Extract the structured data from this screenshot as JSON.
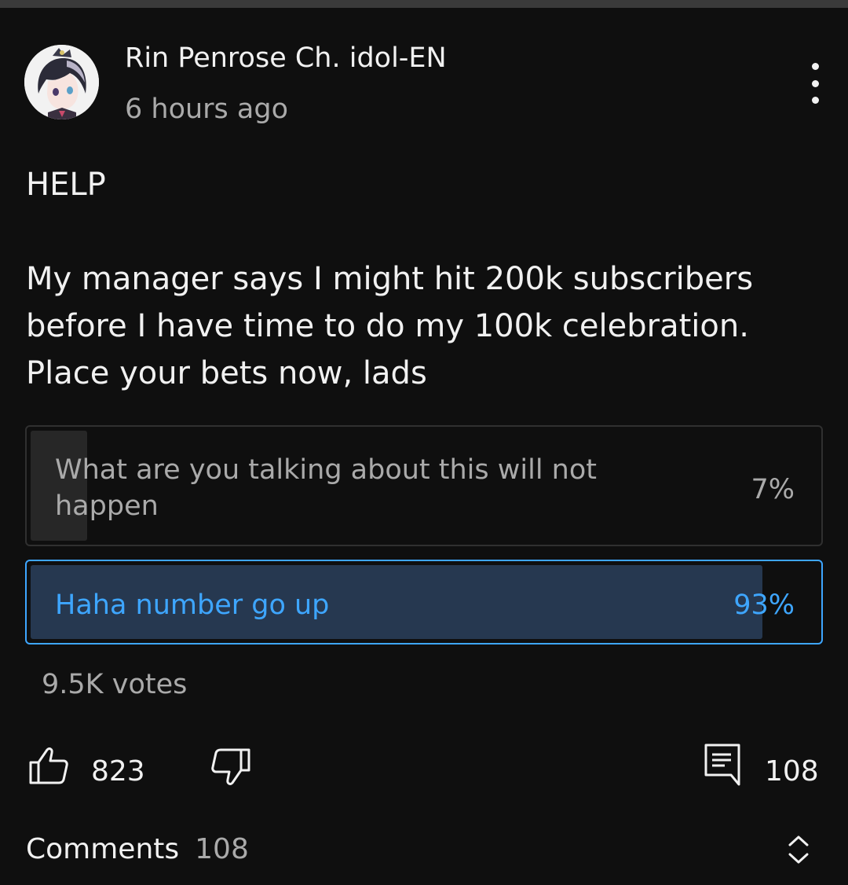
{
  "channel": {
    "name": "Rin Penrose Ch. idol-EN",
    "time": "6 hours ago"
  },
  "post": {
    "lines": [
      "HELP",
      "My manager says I might hit 200k subscribers",
      "before I have time to do my 100k celebration.",
      "Place your bets now, lads"
    ]
  },
  "poll": {
    "options": [
      {
        "label": "What are you talking about this will not happen",
        "percent_label": "7%",
        "percent": 7
      },
      {
        "label": "Haha number go up",
        "percent_label": "93%",
        "percent": 93
      }
    ],
    "votes": "9.5K votes"
  },
  "actions": {
    "likes": "823",
    "comments": "108"
  },
  "comments_header": {
    "label": "Comments",
    "count": "108"
  },
  "colors": {
    "background": "#0f0f0f",
    "accent": "#3ea6ff",
    "muted_text": "#aaaaaa"
  },
  "icons": [
    "more-vert-icon",
    "like-icon",
    "dislike-icon",
    "comment-icon",
    "expand-icon"
  ]
}
